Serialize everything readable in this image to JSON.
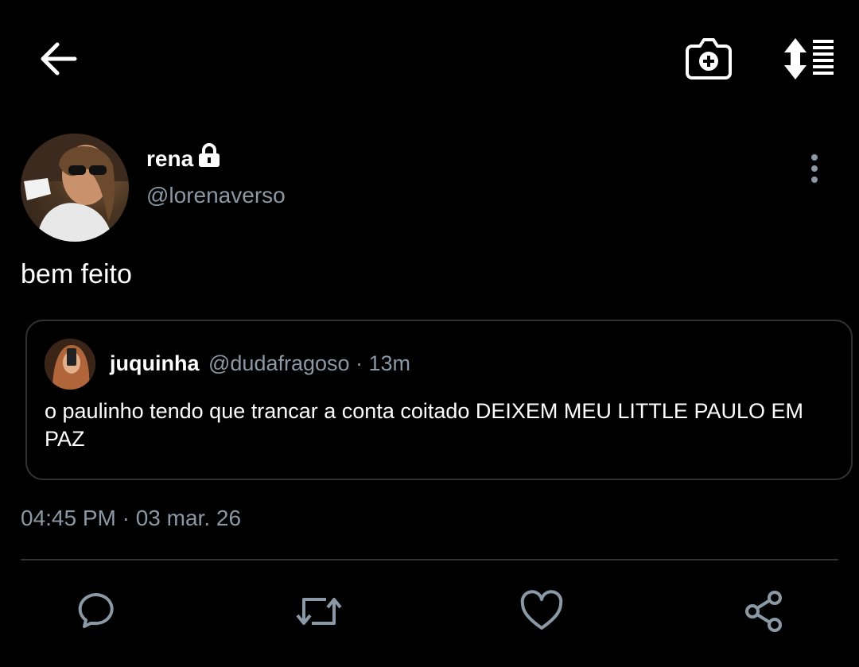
{
  "colors": {
    "background": "#000000",
    "text_primary": "#ffffff",
    "text_secondary": "#8b98a5",
    "border": "#2f3336"
  },
  "toolbar": {
    "back_icon": "arrow-left-icon",
    "camera_icon": "camera-plus-icon",
    "sort_icon": "sort-list-icon"
  },
  "tweet": {
    "display_name": "rena",
    "protected_icon": "lock-icon",
    "handle": "@lorenaverso",
    "text": "bem feito",
    "timestamp": "04:45 PM · 03 mar. 26"
  },
  "quoted_tweet": {
    "display_name": "juquinha",
    "meta": "@dudafragoso · 13m",
    "text": "o paulinho tendo que trancar a conta coitado DEIXEM MEU LITTLE PAULO EM PAZ"
  },
  "actions": {
    "reply_icon": "reply-icon",
    "retweet_icon": "retweet-icon",
    "like_icon": "heart-icon",
    "share_icon": "share-icon"
  }
}
